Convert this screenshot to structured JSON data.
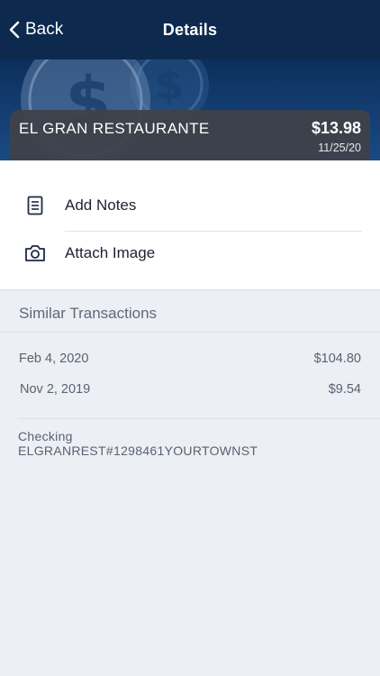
{
  "navbar": {
    "back_label": "Back",
    "title": "Details"
  },
  "transaction": {
    "merchant": "EL GRAN RESTAURANTE",
    "amount": "$13.98",
    "date": "11/25/20"
  },
  "actions": [
    {
      "label": "Add Notes",
      "icon": "document-icon"
    },
    {
      "label": "Attach Image",
      "icon": "camera-icon"
    }
  ],
  "similar": {
    "title": "Similar Transactions",
    "rows": [
      {
        "date": "Feb 4, 2020",
        "amount": "$104.80"
      },
      {
        "date": "Nov 2, 2019",
        "amount": "$9.54"
      }
    ]
  },
  "account": {
    "type": "Checking",
    "description": "ELGRANREST#1298461YOURTOWNST"
  },
  "colors": {
    "navbar": "#0d2a4e",
    "hero": "#143e73",
    "card": "#3e424a",
    "background": "#eceff4"
  }
}
